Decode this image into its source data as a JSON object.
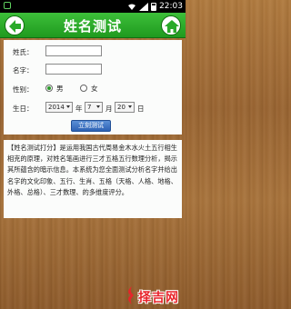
{
  "status_bar": {
    "time": "22:03"
  },
  "header": {
    "title": "姓名测试"
  },
  "form": {
    "surname_label": "姓氏：",
    "surname_value": "",
    "given_name_label": "名字：",
    "given_name_value": "",
    "gender_label": "性别：",
    "gender_options": {
      "male": "男",
      "female": "女"
    },
    "gender_selected": "male",
    "birthday_label": "生日：",
    "year_value": "2014",
    "year_unit": "年",
    "month_value": "7",
    "month_unit": "月",
    "day_value": "20",
    "day_unit": "日",
    "submit_label": "立刻测试"
  },
  "description": {
    "text": "【姓名测试打分】是运用我国古代周易金木水火土五行相生相克的原理，对姓名笔画进行三才五格五行数理分析，揭示其所蕴含的暗示信息。本系统为您全面测试分析名字并给出名字的文化印象、五行、生肖、五格（天格、人格、地格、外格、总格）、三才数理、的多维度评分。"
  },
  "logo": {
    "text": "择吉网",
    "accent": "#e8232a"
  },
  "colors": {
    "titlebar": "#2aaa2a",
    "button": "#2d62b4",
    "background": "#a8733b"
  }
}
